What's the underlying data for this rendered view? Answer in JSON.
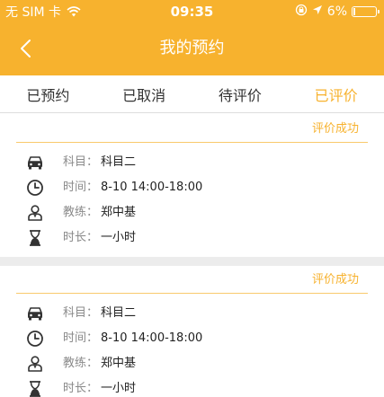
{
  "status_bar": {
    "carrier": "无 SIM 卡",
    "time": "09:35",
    "battery": "6%",
    "battery_level": 0.06
  },
  "nav": {
    "title": "我的预约"
  },
  "tabs": [
    {
      "label": "已预约"
    },
    {
      "label": "已取消"
    },
    {
      "label": "待评价"
    },
    {
      "label": "已评价"
    }
  ],
  "active_tab": 3,
  "colors": {
    "accent": "#f7b22e",
    "label_gray": "#8a8a8a"
  },
  "bookings": [
    {
      "status": "评价成功",
      "subject_label": "科目：",
      "subject": "科目二",
      "time_label": "时间：",
      "time": "8-10  14:00-18:00",
      "coach_label": "教练：",
      "coach": "郑中基",
      "duration_label": "时长：",
      "duration": "一小时"
    },
    {
      "status": "评价成功",
      "subject_label": "科目：",
      "subject": "科目二",
      "time_label": "时间：",
      "time": "8-10  14:00-18:00",
      "coach_label": "教练：",
      "coach": "郑中基",
      "duration_label": "时长：",
      "duration": "一小时"
    }
  ]
}
